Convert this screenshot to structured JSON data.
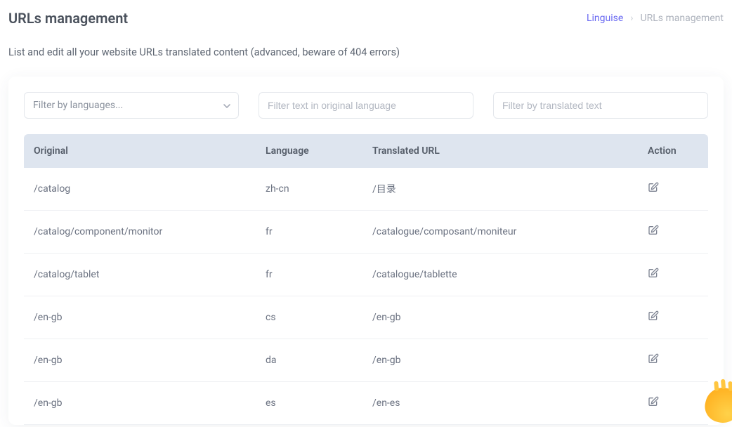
{
  "header": {
    "title": "URLs management",
    "subtitle": "List and edit all your website URLs translated content (advanced, beware of 404 errors)"
  },
  "breadcrumb": {
    "root": "Linguise",
    "separator": "›",
    "current": "URLs management"
  },
  "filters": {
    "language_placeholder": "Filter by languages...",
    "original_placeholder": "Filter text in original language",
    "translated_placeholder": "Filter by translated text"
  },
  "table": {
    "headers": {
      "original": "Original",
      "language": "Language",
      "translated": "Translated URL",
      "action": "Action"
    },
    "rows": [
      {
        "original": "/catalog",
        "language": "zh-cn",
        "translated": "/目录"
      },
      {
        "original": "/catalog/component/monitor",
        "language": "fr",
        "translated": "/catalogue/composant/moniteur"
      },
      {
        "original": "/catalog/tablet",
        "language": "fr",
        "translated": "/catalogue/tablette"
      },
      {
        "original": "/en-gb",
        "language": "cs",
        "translated": "/en-gb"
      },
      {
        "original": "/en-gb",
        "language": "da",
        "translated": "/en-gb"
      },
      {
        "original": "/en-gb",
        "language": "es",
        "translated": "/en-es"
      }
    ]
  }
}
